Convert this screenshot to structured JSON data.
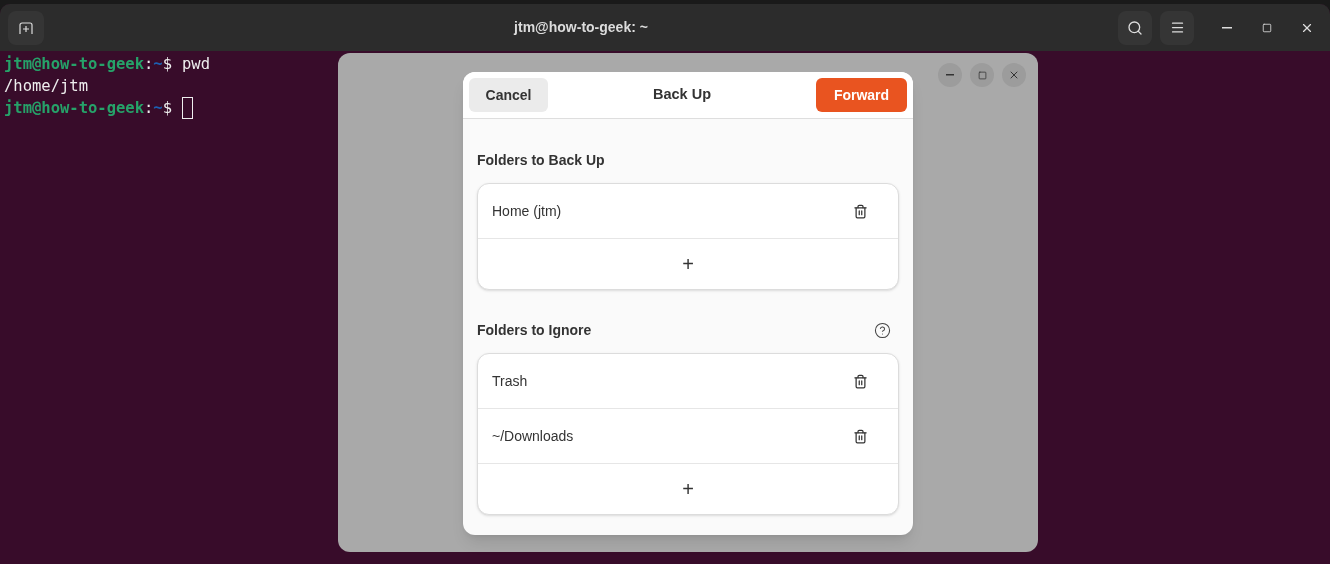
{
  "terminal": {
    "title": "jtm@how-to-geek: ~",
    "lines": [
      {
        "kind": "prompt",
        "user_host": "jtm@how-to-geek",
        "separator": ":",
        "path": "~",
        "symbol": "$",
        "command": "pwd",
        "cursor": false
      },
      {
        "kind": "output",
        "text": "/home/jtm"
      },
      {
        "kind": "prompt",
        "user_host": "jtm@how-to-geek",
        "separator": ":",
        "path": "~",
        "symbol": "$",
        "cursor": true
      }
    ]
  },
  "dialog": {
    "title": "Back Up",
    "cancel": "Cancel",
    "forward": "Forward",
    "sections": [
      {
        "heading": "Folders to Back Up",
        "help": false,
        "add": "+",
        "folders": [
          "Home (jtm)"
        ]
      },
      {
        "heading": "Folders to Ignore",
        "help": true,
        "add": "+",
        "folders": [
          "Trash",
          "~/Downloads"
        ]
      }
    ]
  }
}
